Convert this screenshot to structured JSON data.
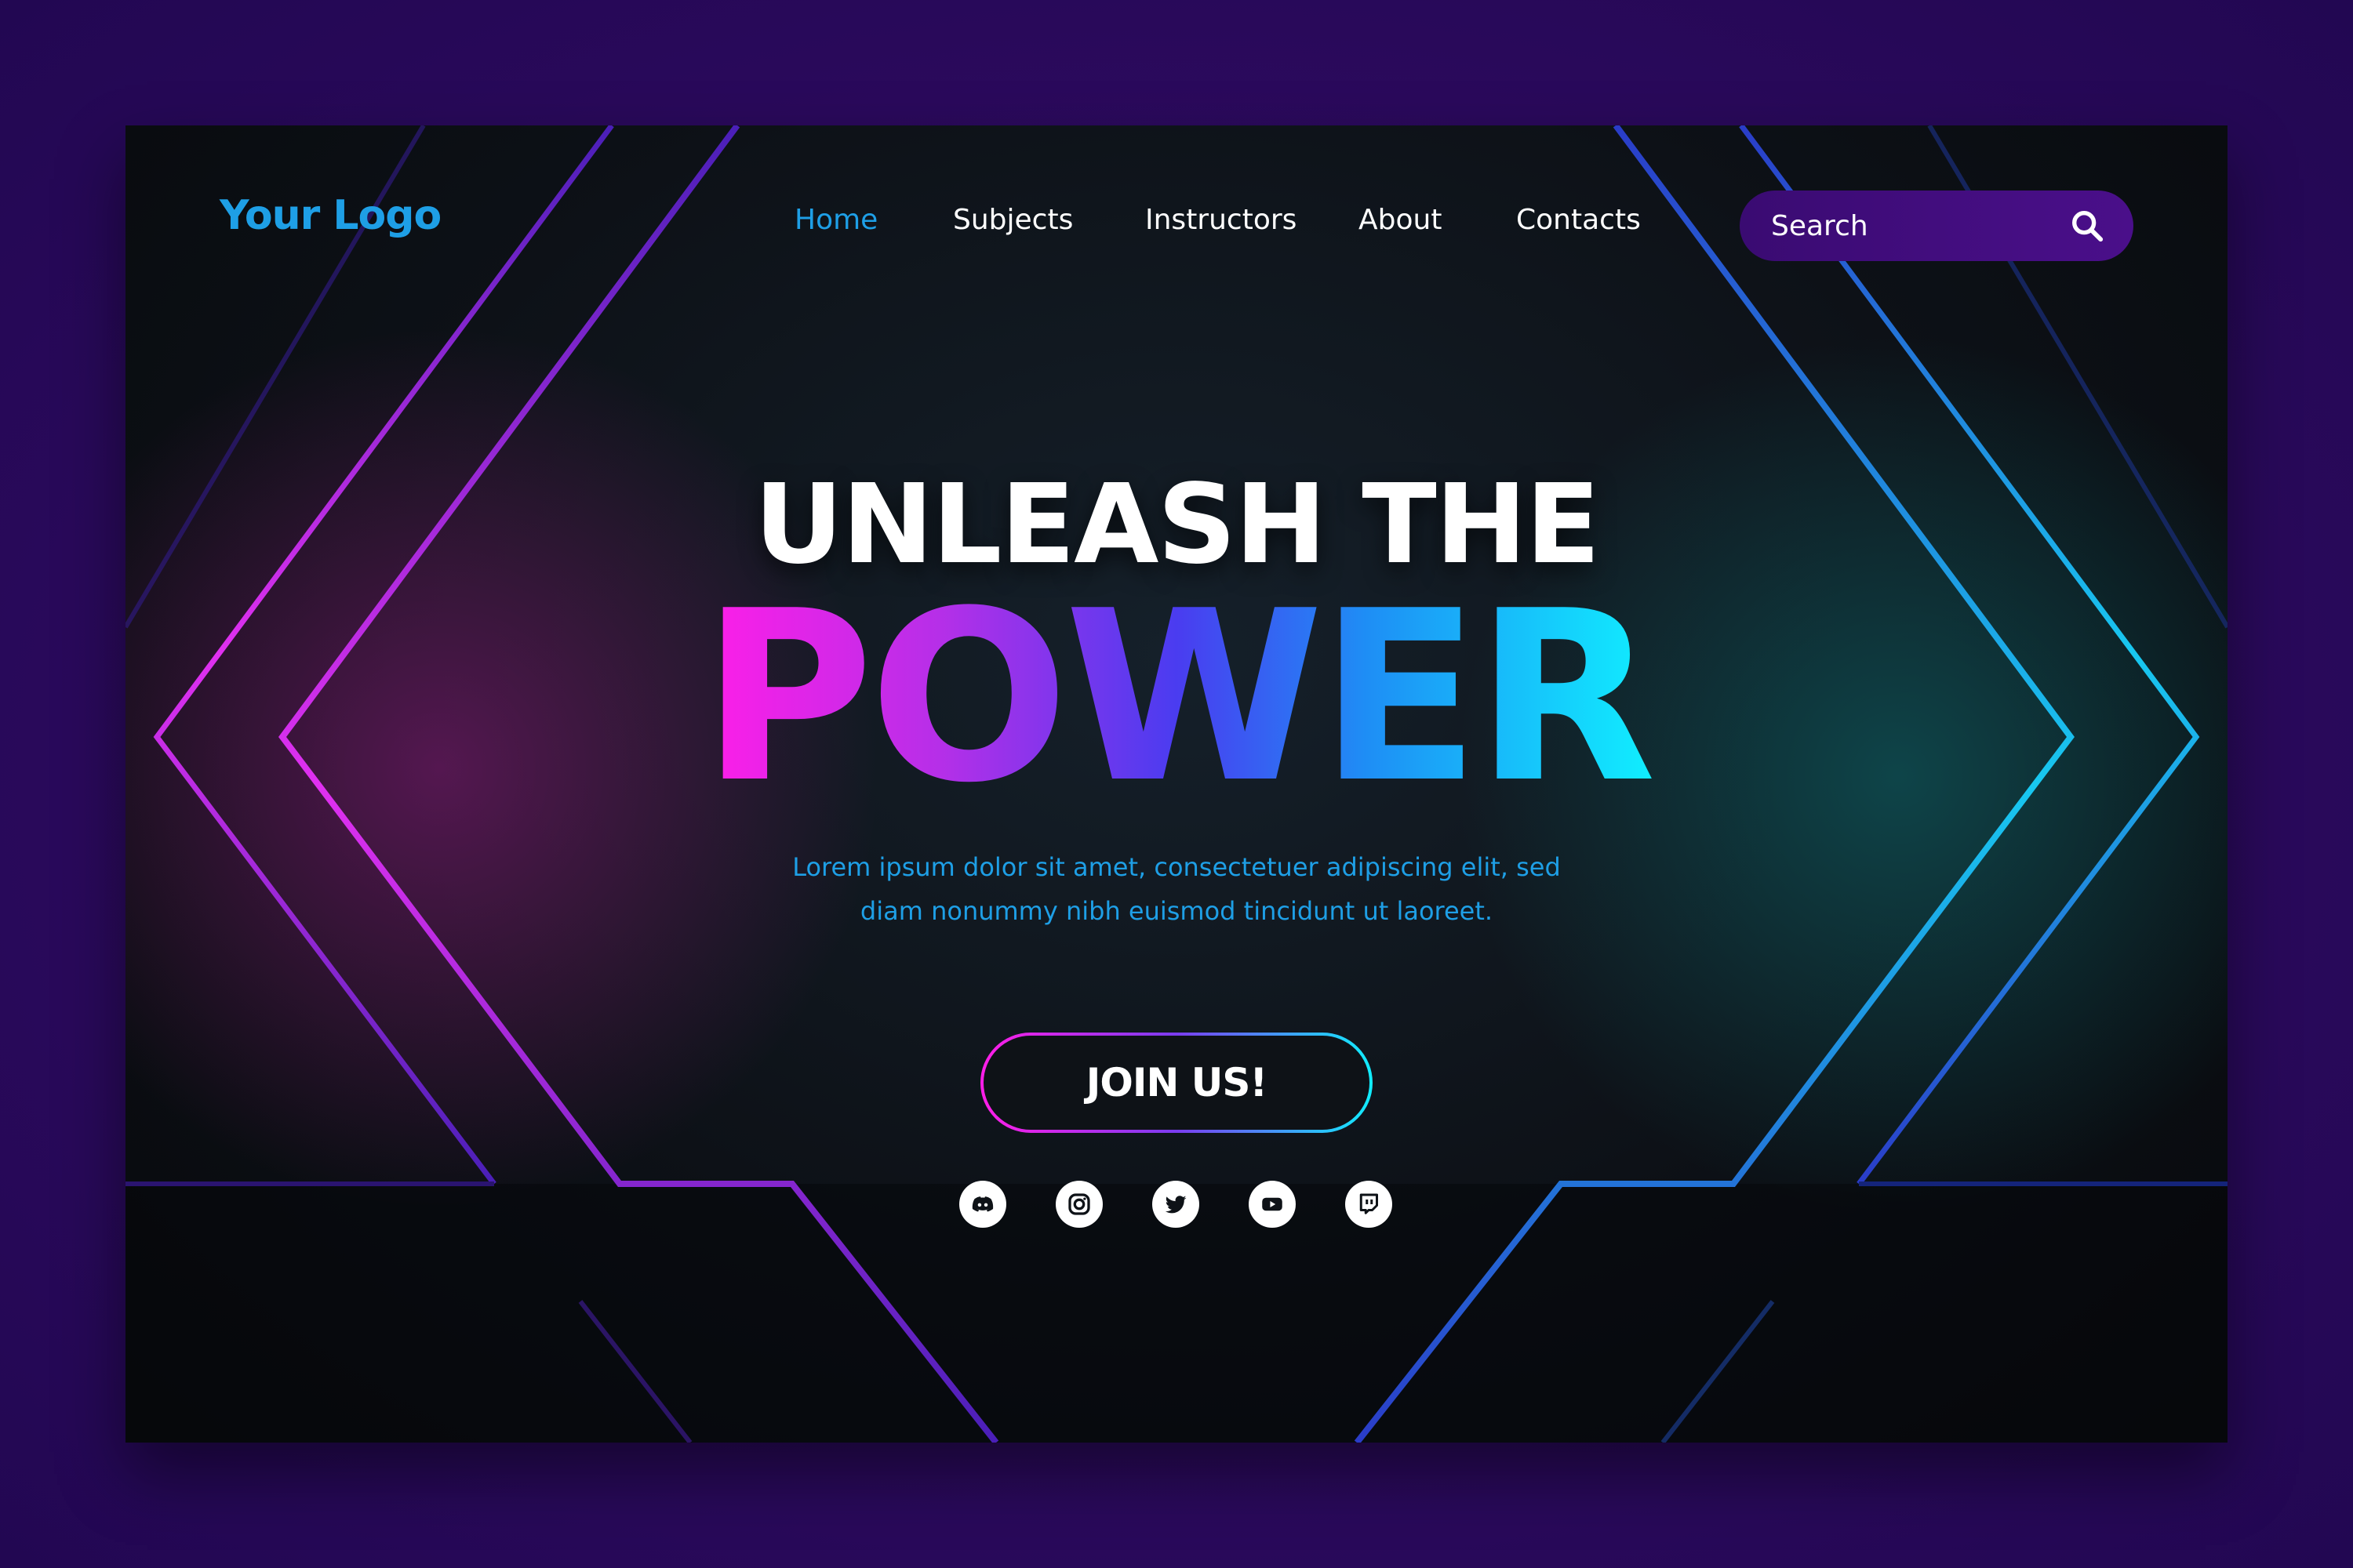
{
  "colors": {
    "accent_blue": "#1e9fe6",
    "magenta": "#ff1ee8",
    "cyan": "#10eeff",
    "outer_bg": "#2c0a5e",
    "panel_bg": "#0d1117"
  },
  "header": {
    "logo": "Your Logo",
    "nav": [
      {
        "label": "Home",
        "active": true
      },
      {
        "label": "Subjects",
        "active": false
      },
      {
        "label": "Instructors",
        "active": false
      },
      {
        "label": "About",
        "active": false
      },
      {
        "label": "Contacts",
        "active": false
      }
    ],
    "search": {
      "placeholder": "Search",
      "icon": "search-icon"
    }
  },
  "hero": {
    "line1": "UNLEASH THE",
    "line2": "POWER",
    "subtitle_line1": "Lorem ipsum dolor sit amet, consectetuer adipiscing elit, sed",
    "subtitle_line2": "diam nonummy nibh euismod tincidunt ut laoreet.",
    "cta": "JOIN US!"
  },
  "social": [
    {
      "icon": "discord-icon"
    },
    {
      "icon": "instagram-icon"
    },
    {
      "icon": "twitter-icon"
    },
    {
      "icon": "youtube-icon"
    },
    {
      "icon": "twitch-icon"
    }
  ]
}
